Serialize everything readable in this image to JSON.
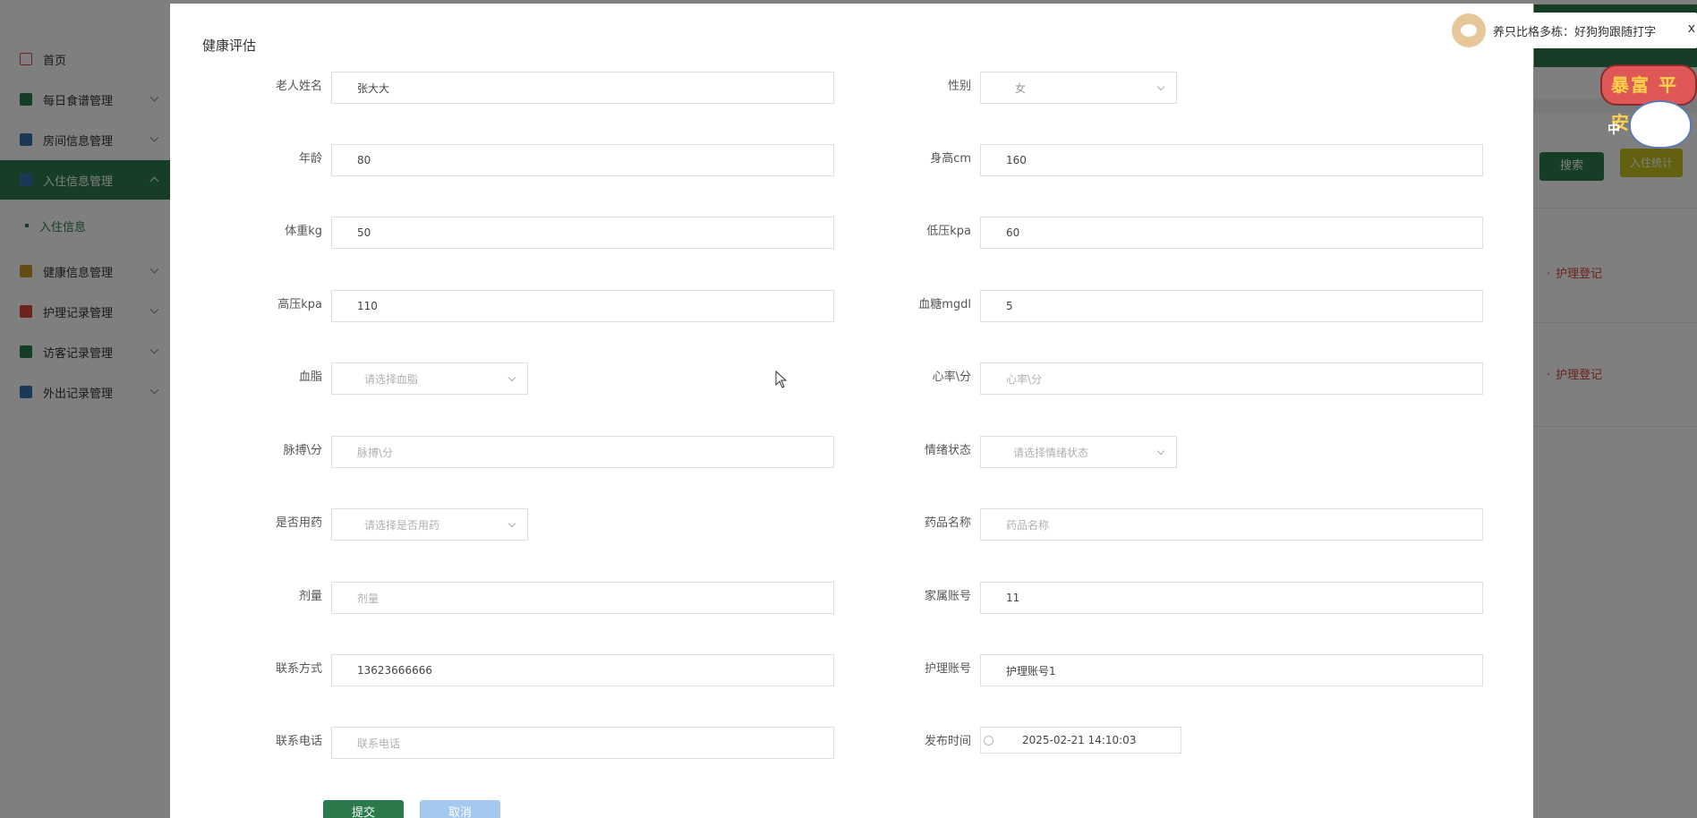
{
  "sidebar": {
    "items": [
      {
        "label": "首页",
        "color": "#d9473a",
        "has_children": false
      },
      {
        "label": "每日食谱管理",
        "color": "#2c7a4b",
        "has_children": true
      },
      {
        "label": "房间信息管理",
        "color": "#3572b0",
        "has_children": true
      },
      {
        "label": "入住信息管理",
        "color": "#3572b0",
        "has_children": true,
        "active": true
      },
      {
        "label": "健康信息管理",
        "color": "#c79a2b",
        "has_children": true
      },
      {
        "label": "护理记录管理",
        "color": "#d9473a",
        "has_children": true
      },
      {
        "label": "访客记录管理",
        "color": "#2c7a4b",
        "has_children": true
      },
      {
        "label": "外出记录管理",
        "color": "#3572b0",
        "has_children": true
      }
    ],
    "sub_item": "入住信息"
  },
  "background": {
    "search_button": "搜索",
    "stats_button": "入住统计",
    "row_links": [
      "护理登记",
      "护理登记"
    ]
  },
  "modal": {
    "title": "健康评估",
    "fields": {
      "name": {
        "label": "老人姓名",
        "value": "张大大"
      },
      "gender": {
        "label": "性别",
        "value": "女"
      },
      "age": {
        "label": "年龄",
        "value": "80"
      },
      "height": {
        "label": "身高cm",
        "value": "160"
      },
      "weight": {
        "label": "体重kg",
        "value": "50"
      },
      "low_pressure": {
        "label": "低压kpa",
        "value": "60"
      },
      "high_pressure": {
        "label": "高压kpa",
        "value": "110"
      },
      "blood_sugar": {
        "label": "血糖mgdl",
        "value": "5"
      },
      "blood_lipid": {
        "label": "血脂",
        "placeholder": "请选择血脂"
      },
      "heart_rate": {
        "label": "心率\\分",
        "placeholder": "心率\\分"
      },
      "pulse": {
        "label": "脉搏\\分",
        "placeholder": "脉搏\\分"
      },
      "mood": {
        "label": "情绪状态",
        "placeholder": "请选择情绪状态"
      },
      "medication": {
        "label": "是否用药",
        "placeholder": "请选择是否用药"
      },
      "drug_name": {
        "label": "药品名称",
        "placeholder": "药品名称"
      },
      "dosage": {
        "label": "剂量",
        "placeholder": "剂量"
      },
      "family_account": {
        "label": "家属账号",
        "value": "11"
      },
      "contact": {
        "label": "联系方式",
        "value": "13623666666"
      },
      "nurse_account": {
        "label": "护理账号",
        "value": "护理账号1"
      },
      "phone": {
        "label": "联系电话",
        "placeholder": "联系电话"
      },
      "publish_time": {
        "label": "发布时间",
        "value": "2025-02-21 14:10:03"
      }
    },
    "submit": "提交",
    "cancel": "取消"
  },
  "widget": {
    "text": "养只比格多栋：好狗狗跟随打字",
    "close": "x",
    "sticker_text": "暴富 平安",
    "sticker_small": "中"
  },
  "colors": {
    "primary": "#2c7a4b",
    "cancel": "#a5c8ee",
    "link_red": "#d9473a"
  }
}
